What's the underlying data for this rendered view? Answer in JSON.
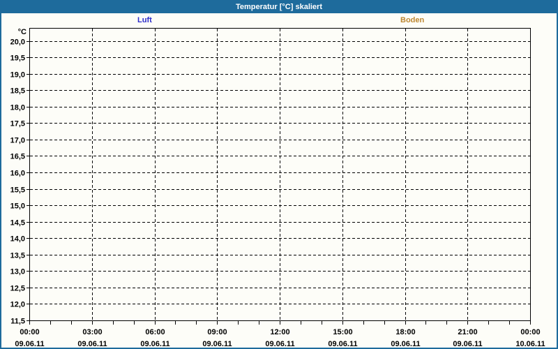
{
  "window": {
    "title": "Temperatur [°C] skaliert"
  },
  "legend": {
    "items": [
      {
        "label": "Luft",
        "color": "#2d2dcb"
      },
      {
        "label": "Boden",
        "color": "#bd8732"
      }
    ]
  },
  "chart_data": {
    "type": "line",
    "title": "Temperatur [°C] skaliert",
    "ylabel": "°C",
    "y_axis": {
      "unit_label": "°C",
      "min": 11.5,
      "max": 20.0,
      "step": 0.5,
      "tick_labels": [
        "20,0",
        "19,5",
        "19,0",
        "18,5",
        "18,0",
        "17,5",
        "17,0",
        "16,5",
        "16,0",
        "15,5",
        "15,0",
        "14,5",
        "14,0",
        "13,5",
        "13,0",
        "12,5",
        "12,0",
        "11,5"
      ],
      "grid": "dashed"
    },
    "x_axis": {
      "range_hours": 24,
      "minor_tick_interval_hours": 1,
      "major_tick_interval_hours": 3,
      "grid": "dashed",
      "ticks": [
        {
          "time": "00:00",
          "date": "09.06.11"
        },
        {
          "time": "03:00",
          "date": "09.06.11"
        },
        {
          "time": "06:00",
          "date": "09.06.11"
        },
        {
          "time": "09:00",
          "date": "09.06.11"
        },
        {
          "time": "12:00",
          "date": "09.06.11"
        },
        {
          "time": "15:00",
          "date": "09.06.11"
        },
        {
          "time": "18:00",
          "date": "09.06.11"
        },
        {
          "time": "21:00",
          "date": "09.06.11"
        },
        {
          "time": "00:00",
          "date": "10.06.11"
        }
      ]
    },
    "series": [
      {
        "name": "Luft",
        "color": "#2d2dcb",
        "values": []
      },
      {
        "name": "Boden",
        "color": "#bd8732",
        "values": []
      }
    ]
  },
  "colors": {
    "titlebar": "#1e6b9c",
    "titlebar_text": "#ffffff",
    "window_border": "#1e6b9c",
    "grid": "#000000",
    "axis": "#000000",
    "background": "#fdfdf8",
    "plot_background": "#fdfdf8"
  }
}
